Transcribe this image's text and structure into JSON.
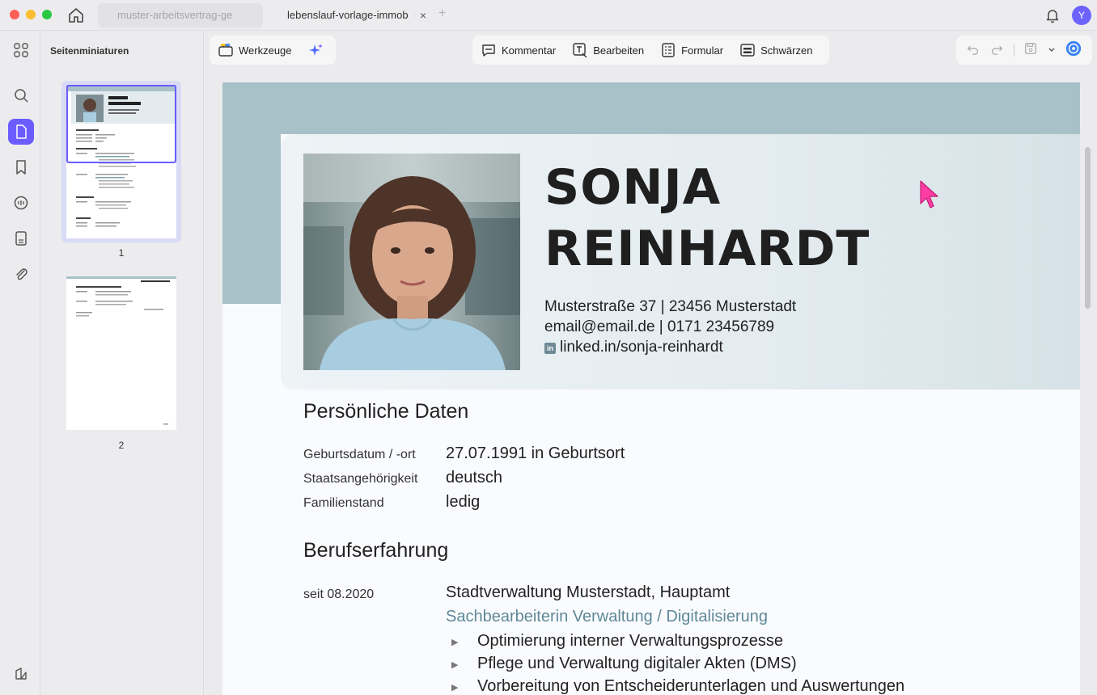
{
  "browser": {
    "tabs": [
      {
        "label": "muster-arbeitsvertrag-ge"
      },
      {
        "label": "lebenslauf-vorlage-immob"
      }
    ],
    "tab_close": "×",
    "tab_add": "+",
    "avatar_initial": "Y"
  },
  "sidebar": {
    "title": "Seitenminiaturen",
    "pages": [
      {
        "number": "1"
      },
      {
        "number": "2"
      }
    ]
  },
  "toolbar": {
    "tools_label": "Werkzeuge",
    "comment_label": "Kommentar",
    "edit_label": "Bearbeiten",
    "form_label": "Formular",
    "redact_label": "Schwärzen"
  },
  "resume": {
    "first_name": "SONJA",
    "last_name": "REINHARDT",
    "address": "Musterstraße 37  |  23456 Musterstadt",
    "email_phone": "email@email.de  |  0171 23456789",
    "linkedin": "linked.in/sonja-reinhardt",
    "linkedin_badge": "in",
    "personal": {
      "title": "Persönliche Daten",
      "rows": [
        {
          "label": "Geburtsdatum / -ort",
          "value": "27.07.1991 in Geburtsort"
        },
        {
          "label": "Staatsangehörigkeit",
          "value": "deutsch"
        },
        {
          "label": "Familienstand",
          "value": "ledig"
        }
      ]
    },
    "experience": {
      "title": "Berufserfahrung",
      "jobs": [
        {
          "date": "seit 08.2020",
          "employer": "Stadtverwaltung Musterstadt, Hauptamt",
          "role": "Sachbearbeiterin Verwaltung / Digitalisierung",
          "bullets": [
            "Optimierung interner Verwaltungsprozesse",
            "Pflege und Verwaltung digitaler Akten (DMS)",
            "Vorbereitung von Entscheiderunterlagen und Auswertungen"
          ]
        }
      ]
    }
  },
  "colors": {
    "accent": "#6a5cff",
    "header_band": "#a8c1c8",
    "role_text": "#5e8898",
    "cursor": "#ff3ea5"
  },
  "icons": [
    "home-icon",
    "bell-icon",
    "grid-icon",
    "search-icon",
    "page-icon",
    "bookmark-icon",
    "comment-icon",
    "form-icon",
    "attachment-icon",
    "sidebar-toggle-icon",
    "tools-icon",
    "ai-sparkle-icon",
    "undo-icon",
    "redo-icon",
    "save-icon",
    "chevron-down-icon",
    "ai-assistant-icon"
  ]
}
